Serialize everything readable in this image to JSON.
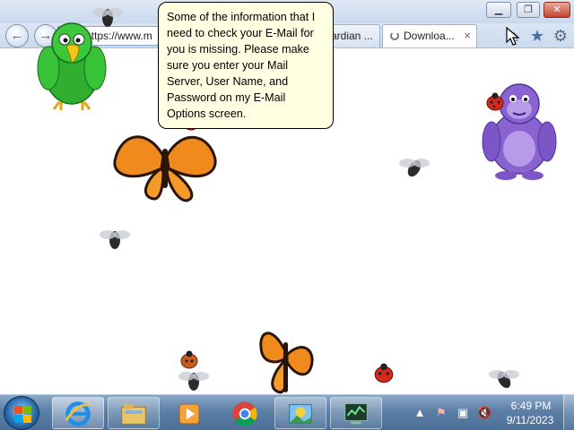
{
  "browser": {
    "address_text": "https://www.m",
    "tabs": [
      {
        "label": "ardian ..."
      },
      {
        "label": "Downloa..."
      }
    ],
    "tab_close_glyph": "×",
    "icons": [
      "back-icon",
      "forward-icon",
      "home-icon",
      "star-icon",
      "gear-icon"
    ]
  },
  "balloon": {
    "text": "Some of the information that I need to check your E-Mail for you is missing. Please make sure you enter your Mail Server, User Name, and Password on my E-Mail Options screen."
  },
  "characters": {
    "parrot_color": "#2fae2f",
    "gorilla_color": "#8a63d2",
    "butterfly_color": "#f08a1c",
    "ladybug_color": "#d62a1f"
  },
  "taskbar": {
    "pinned": [
      "internet-explorer-icon",
      "file-explorer-icon",
      "media-player-icon",
      "chrome-icon",
      "photo-gallery-icon",
      "network-monitor-icon"
    ],
    "clock_time": "6:49 PM",
    "clock_date": "9/11/2023"
  }
}
